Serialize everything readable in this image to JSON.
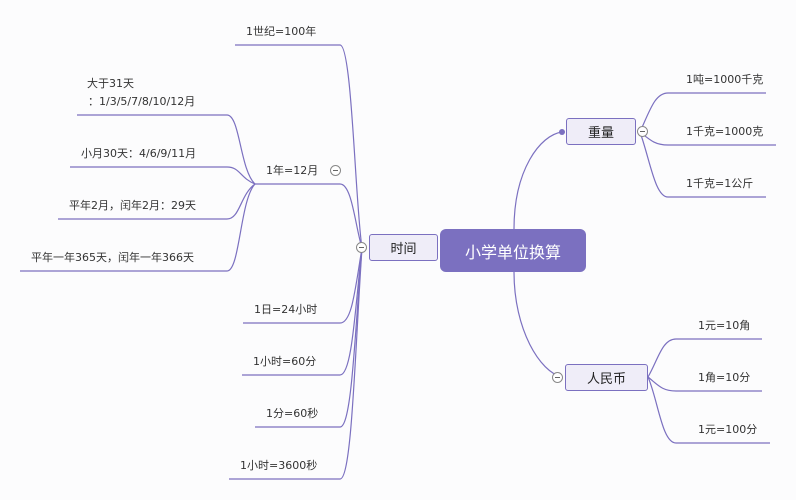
{
  "root": {
    "label": "小学单位换算",
    "color": "#7b70c0"
  },
  "branches": {
    "time": {
      "label": "时间",
      "children": [
        {
          "label": "1世纪=100年"
        },
        {
          "label": "1年=12月",
          "children": [
            {
              "label_line1": "大于31天",
              "label_line2": "：1/3/5/7/8/10/12月"
            },
            {
              "label": "小月30天：4/6/9/11月"
            },
            {
              "label": "平年2月，闰年2月：29天"
            },
            {
              "label": "平年一年365天，闰年一年366天"
            }
          ]
        },
        {
          "label": "1日=24小时"
        },
        {
          "label": "1小时=60分"
        },
        {
          "label": "1分=60秒"
        },
        {
          "label": "1小时=3600秒"
        }
      ]
    },
    "weight": {
      "label": "重量",
      "children": [
        {
          "label": "1吨=1000千克"
        },
        {
          "label": "1千克=1000克"
        },
        {
          "label": "1千克=1公斤"
        }
      ]
    },
    "money": {
      "label": "人民币",
      "children": [
        {
          "label": "1元=10角"
        },
        {
          "label": "1角=10分"
        },
        {
          "label": "1元=100分"
        }
      ]
    }
  },
  "line_color": "#7b70c0"
}
